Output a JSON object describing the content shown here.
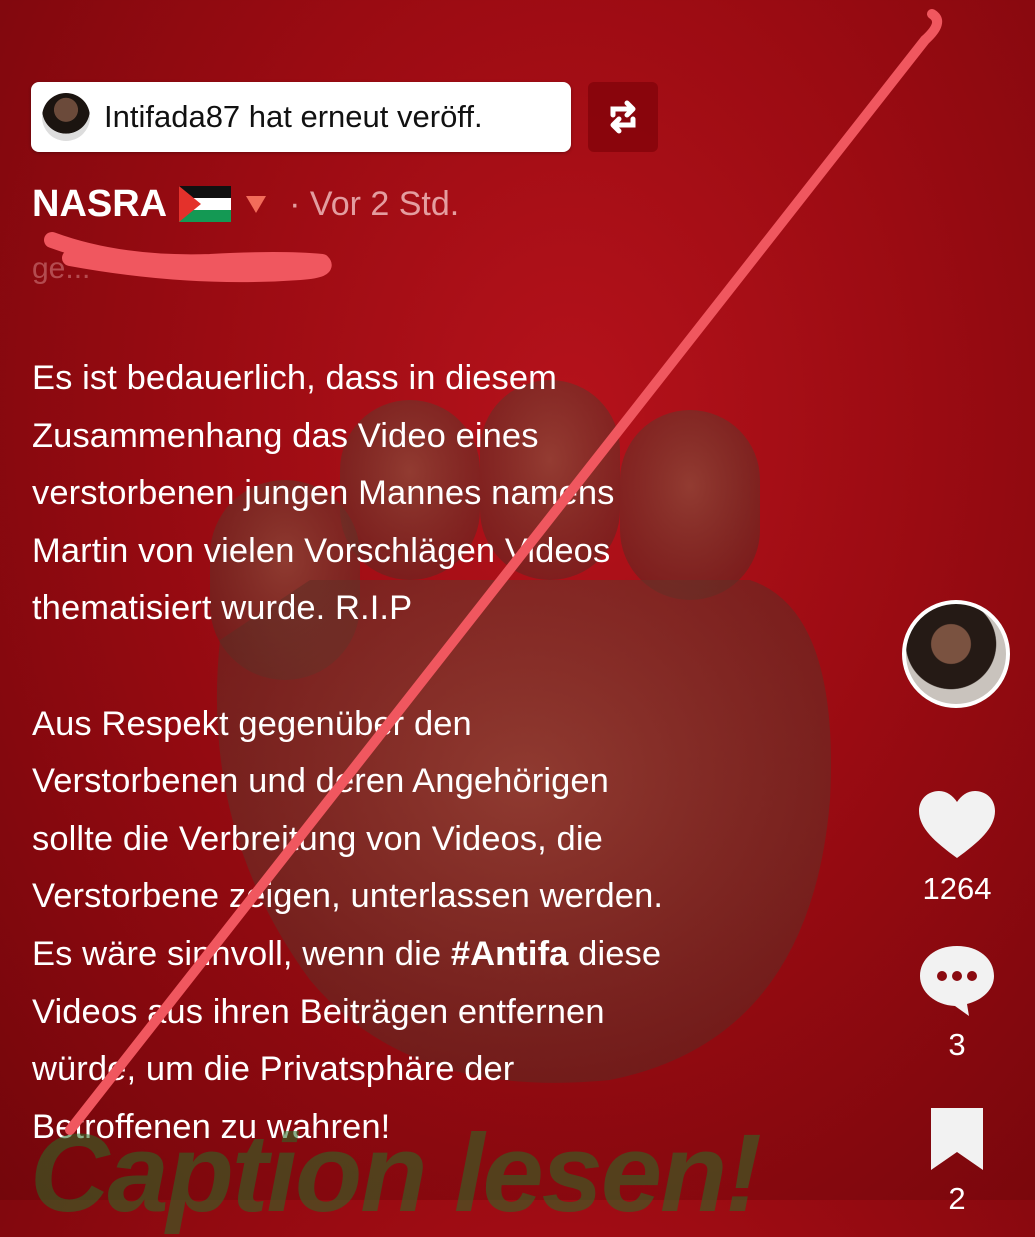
{
  "repost": {
    "text": "Intifada87 hat erneut veröff."
  },
  "post": {
    "author": "NASRA",
    "time": "· Vor 2 Std.",
    "faded_line": "ge..."
  },
  "caption": {
    "lines": [
      "Es ist bedauerlich, dass in diesem",
      "Zusammenhang das Video eines",
      "verstorbenen jungen Mannes namens",
      "Martin von vielen Vorschlägen Videos",
      "thematisiert wurde. R.I.P",
      "",
      "Aus Respekt gegenüber den",
      "Verstorbenen und deren Angehörigen",
      "sollte die Verbreitung von Videos, die",
      "Verstorbene zeigen, unterlassen werden.",
      "Es wäre sinnvoll, wenn die ",
      "Videos aus ihren Beiträgen entfernen",
      "würde, um die Privatsphäre der",
      "Betroffenen zu wahren!"
    ],
    "hashtag": "#Antifa",
    "after_hashtag": " diese"
  },
  "sidebar": {
    "likes": "1264",
    "comments": "3",
    "bookmarks": "2"
  },
  "watermark": "Caption lesen!",
  "icons": {
    "repost": "repost-icon",
    "like": "heart-icon",
    "comment": "comment-icon",
    "bookmark": "bookmark-icon",
    "flag": "palestine-flag-icon",
    "triangle": "red-triangle-icon"
  },
  "colors": {
    "background": "#9a0b12",
    "annotation": "#f0575f"
  }
}
